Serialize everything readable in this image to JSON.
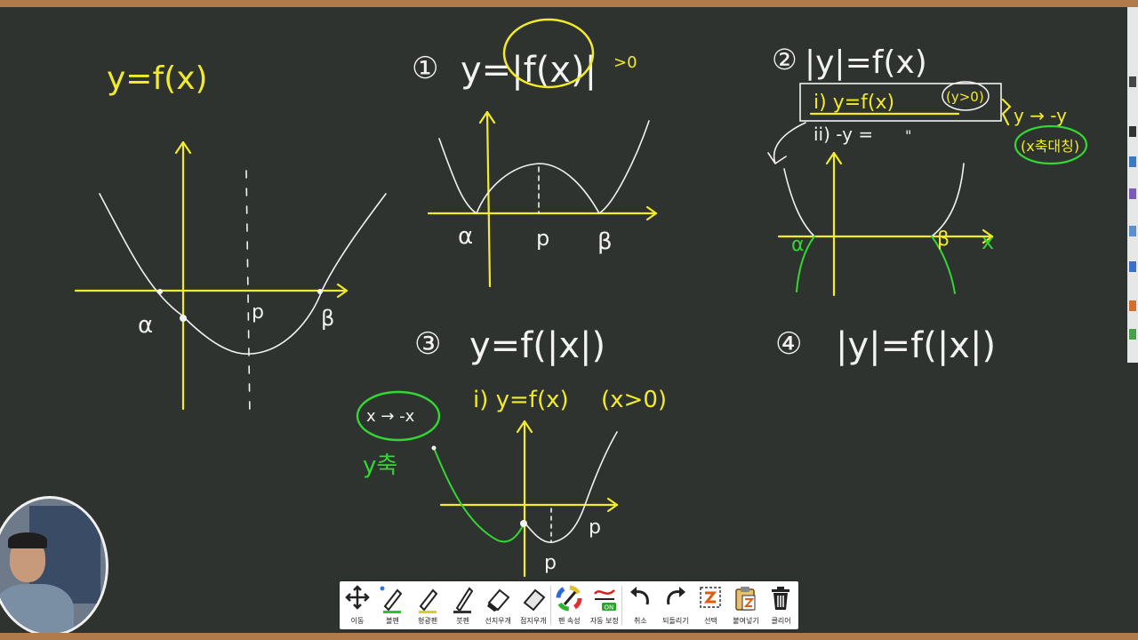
{
  "board": {
    "base_title": "y=f(x)",
    "base_alpha": "α",
    "base_p": "p",
    "base_beta": "β",
    "p1_num": "①",
    "p1_title": "y=|f(x)|",
    "p1_note": ">0",
    "p1_alpha": "α",
    "p1_p": "p",
    "p1_beta": "β",
    "p2_num": "②",
    "p2_title": "|y|=f(x)",
    "p2_case1": "i) y=f(x)",
    "p2_case1_cond": "(y>0)",
    "p2_case2": "ii) -y =",
    "p2_case2_ditto": "\"",
    "p2_sym": "y → -y",
    "p2_sym_note": "(x축대칭)",
    "p2_alpha": "α",
    "p2_beta": "β",
    "p2_x": "x",
    "p3_num": "③",
    "p3_title": "y=f(|x|)",
    "p3_case1": "i) y=f(x)",
    "p3_case1_cond": "(x>0)",
    "p3_sym": "x → -x",
    "p3_sym_note": "y축",
    "p3_p_left": "p",
    "p3_p_right": "p",
    "p4_num": "④",
    "p4_title": "|y|=f(|x|)"
  },
  "toolbar": {
    "move": "이동",
    "pen": "볼펜",
    "highlighter": "형광펜",
    "brush": "붓펜",
    "line_eraser": "선지우개",
    "area_eraser": "점지우개",
    "pen_props": "펜 속성",
    "auto_correct": "자동 보정",
    "auto_badge": "ON",
    "undo": "취소",
    "redo": "되돌리기",
    "select": "선택",
    "paste": "붙여넣기",
    "clear": "클리어"
  },
  "colors": {
    "board": "#2e3330",
    "chalk_yellow": "#f2ea2a",
    "chalk_white": "#f2f2f2",
    "chalk_green": "#33d633",
    "frame": "#b07a4a"
  }
}
